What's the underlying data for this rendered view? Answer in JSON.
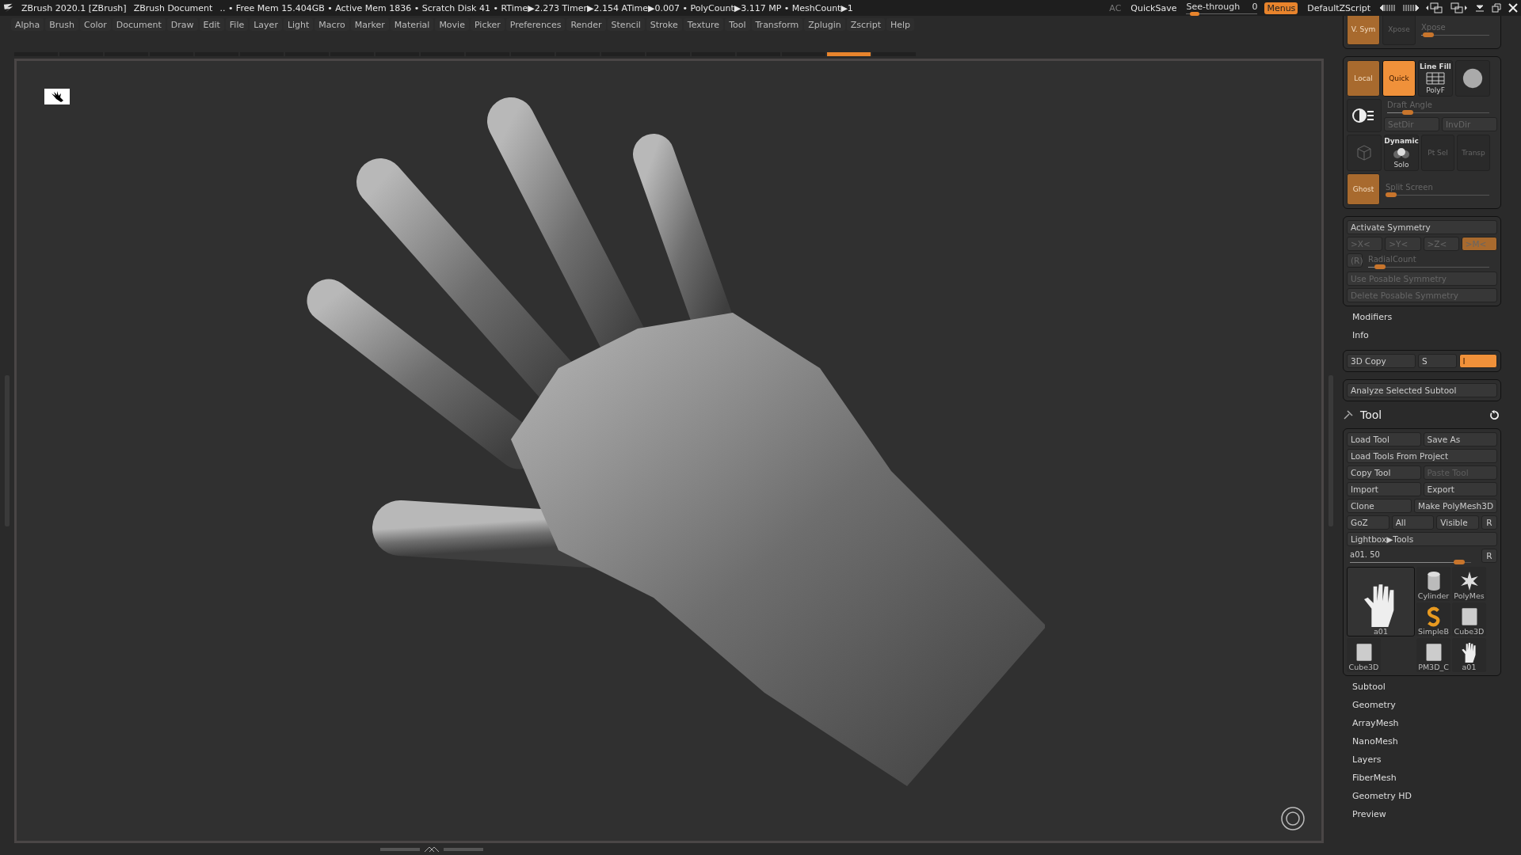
{
  "title_bar": {
    "app_title": "ZBrush 2020.1 [ZBrush]",
    "document": "ZBrush Document",
    "stats": ".. • Free Mem 15.404GB • Active Mem 1836 • Scratch Disk 41 • RTime▶2.273 Timer▶2.154 ATime▶0.007 • PolyCount▶3.117 MP • MeshCount▶1",
    "ac": "AC",
    "quicksave": "QuickSave",
    "see_through": {
      "label": "See-through",
      "value": "0",
      "level": 0.05
    },
    "menus": {
      "label": "Menus",
      "on": true
    },
    "script": "DefaultZScript"
  },
  "menu_bar": [
    "Alpha",
    "Brush",
    "Color",
    "Document",
    "Draw",
    "Edit",
    "File",
    "Layer",
    "Light",
    "Macro",
    "Marker",
    "Material",
    "Movie",
    "Picker",
    "Preferences",
    "Render",
    "Stencil",
    "Stroke",
    "Texture",
    "Tool",
    "Transform",
    "Zplugin",
    "Zscript",
    "Help"
  ],
  "right_panel": {
    "sym_panel": {
      "vsym": {
        "label": "V. Sym",
        "on": true
      },
      "xpose_button": "Xpose",
      "xpose_slider": {
        "label": "Xpose",
        "level": 0.1
      }
    },
    "transp_panel": {
      "local": {
        "label": "Local",
        "on": true
      },
      "quick": {
        "label": "Quick",
        "on": true
      },
      "line_fill": "Line Fill",
      "polyf": "PolyF",
      "draft_angle": {
        "label": "Draft Angle",
        "level": 0.2
      },
      "setdir": "SetDir",
      "invdir": "InvDir",
      "dynamic": "Dynamic",
      "solo": "Solo",
      "ptsel": "Pt Sel",
      "transp": "Transp",
      "ghost": {
        "label": "Ghost",
        "on": true
      },
      "split_screen": {
        "label": "Split Screen",
        "level": 0.05
      }
    },
    "symmetry_panel": {
      "activate": "Activate Symmetry",
      "axes": [
        {
          "label": ">X<",
          "on": false
        },
        {
          "label": ">Y<",
          "on": false
        },
        {
          "label": ">Z<",
          "on": false
        },
        {
          "label": ">M<",
          "on": true
        }
      ],
      "radial_r": "(R)",
      "radial_count": {
        "label": "RadialCount",
        "level": 0.1
      },
      "use_posable": "Use Posable Symmetry",
      "delete_posable": "Delete Posable Symmetry"
    },
    "sections_a": [
      "Modifiers",
      "Info"
    ],
    "copy_panel": {
      "copy": "3D Copy",
      "s": "S",
      "i": {
        "label": "I",
        "on": true
      }
    },
    "analyze": "Analyze Selected Subtool",
    "tool_title": "Tool",
    "tool_rows": [
      [
        {
          "label": "Load Tool",
          "disabled": false
        },
        {
          "label": "Save As",
          "disabled": false
        }
      ],
      [
        {
          "label": "Load Tools From Project",
          "disabled": false
        }
      ],
      [
        {
          "label": "Copy Tool",
          "disabled": false
        },
        {
          "label": "Paste Tool",
          "disabled": true
        }
      ],
      [
        {
          "label": "Import",
          "disabled": false
        },
        {
          "label": "Export",
          "disabled": false
        }
      ],
      [
        {
          "label": "Clone",
          "disabled": false
        },
        {
          "label": "Make PolyMesh3D",
          "disabled": false
        }
      ],
      [
        {
          "label": "GoZ",
          "disabled": false
        },
        {
          "label": "All",
          "disabled": false
        },
        {
          "label": "Visible",
          "disabled": false
        },
        {
          "label": "R",
          "disabled": false
        }
      ],
      [
        {
          "label": "Lightbox▶Tools",
          "disabled": false
        }
      ]
    ],
    "tool_slider": {
      "label": "a01. 50",
      "level": 0.9,
      "reset": "R"
    },
    "tools": [
      {
        "label": "a01",
        "kind": "hand",
        "selected": true
      },
      {
        "label": "Cylinder",
        "kind": "cylinder",
        "selected": false
      },
      {
        "label": "PolyMes",
        "kind": "star",
        "selected": false
      },
      {
        "label": "SimpleB",
        "kind": "s",
        "selected": false
      },
      {
        "label": "Cube3D",
        "kind": "cube",
        "selected": false
      },
      {
        "label": "Cube3D",
        "kind": "cube",
        "selected": false
      },
      {
        "label": "PM3D_C",
        "kind": "cube",
        "selected": false
      },
      {
        "label": "a01",
        "kind": "hand",
        "selected": false
      }
    ],
    "sections_b": [
      "Subtool",
      "Geometry",
      "ArrayMesh",
      "NanoMesh",
      "Layers",
      "FiberMesh",
      "Geometry HD",
      "Preview"
    ]
  }
}
